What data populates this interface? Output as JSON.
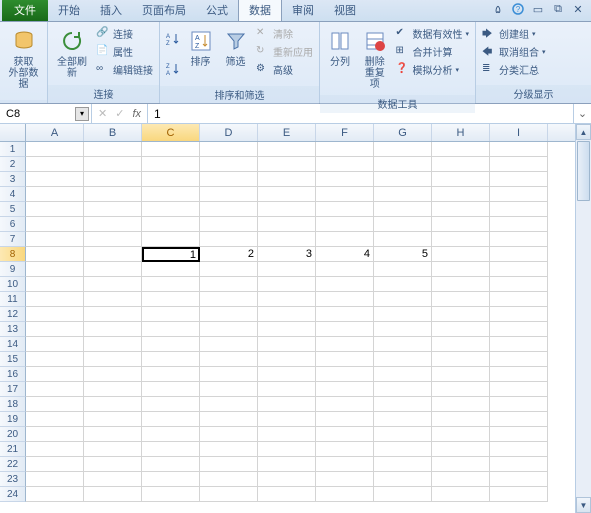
{
  "tabs": {
    "file": "文件",
    "items": [
      "开始",
      "插入",
      "页面布局",
      "公式",
      "数据",
      "审阅",
      "视图"
    ],
    "active_index": 4
  },
  "ribbon": {
    "g1": {
      "label": "",
      "get_external": "获取\n外部数据"
    },
    "g2": {
      "label": "连接",
      "refresh_all": "全部刷新",
      "connections": "连接",
      "properties": "属性",
      "edit_links": "编辑链接"
    },
    "g3": {
      "label": "排序和筛选",
      "sort": "排序",
      "filter": "筛选",
      "clear": "清除",
      "reapply": "重新应用",
      "advanced": "高级"
    },
    "g4": {
      "label": "数据工具",
      "text_to_cols": "分列",
      "remove_dup": "删除\n重复项",
      "data_valid": "数据有效性",
      "consolidate": "合并计算",
      "whatif": "模拟分析"
    },
    "g5": {
      "label": "分级显示",
      "group": "创建组",
      "ungroup": "取消组合",
      "subtotal": "分类汇总"
    }
  },
  "formula_bar": {
    "name_box": "C8",
    "fx": "fx",
    "value": "1"
  },
  "grid": {
    "columns": [
      "A",
      "B",
      "C",
      "D",
      "E",
      "F",
      "G",
      "H",
      "I"
    ],
    "active_col": "C",
    "active_row": 8,
    "row_count": 24,
    "cells": {
      "8": {
        "C": "1",
        "D": "2",
        "E": "3",
        "F": "4",
        "G": "5"
      }
    }
  },
  "chart_data": {
    "type": "table",
    "note": "spreadsheet values",
    "row": 8,
    "columns": [
      "C",
      "D",
      "E",
      "F",
      "G"
    ],
    "values": [
      1,
      2,
      3,
      4,
      5
    ]
  }
}
